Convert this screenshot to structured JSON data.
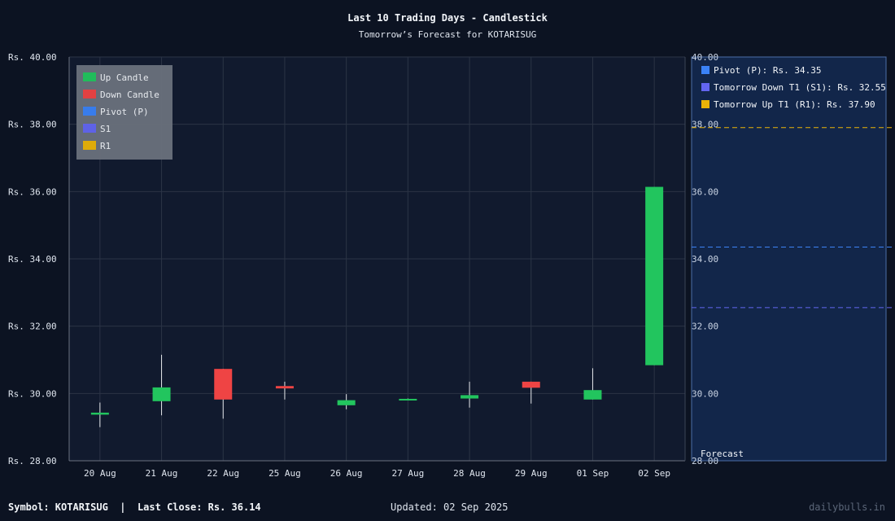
{
  "chart_data": {
    "type": "candlestick",
    "title": "Last 10 Trading Days - Candlestick",
    "subtitle": "Tomorrow’s Forecast for KOTARISUG",
    "categories": [
      "20 Aug",
      "21 Aug",
      "22 Aug",
      "25 Aug",
      "26 Aug",
      "27 Aug",
      "28 Aug",
      "29 Aug",
      "01 Sep",
      "02 Sep"
    ],
    "ohlc": [
      {
        "open": 29.37,
        "high": 29.73,
        "low": 29.0,
        "close": 29.43
      },
      {
        "open": 29.77,
        "high": 31.15,
        "low": 29.35,
        "close": 30.18
      },
      {
        "open": 30.73,
        "high": 30.73,
        "low": 29.25,
        "close": 29.82
      },
      {
        "open": 30.22,
        "high": 30.35,
        "low": 29.82,
        "close": 30.15
      },
      {
        "open": 29.65,
        "high": 29.98,
        "low": 29.53,
        "close": 29.8
      },
      {
        "open": 29.82,
        "high": 29.85,
        "low": 29.8,
        "close": 29.84
      },
      {
        "open": 29.85,
        "high": 30.35,
        "low": 29.58,
        "close": 29.95
      },
      {
        "open": 30.35,
        "high": 30.35,
        "low": 29.7,
        "close": 30.17
      },
      {
        "open": 29.82,
        "high": 30.75,
        "low": 29.82,
        "close": 30.1
      },
      {
        "open": 30.84,
        "high": 36.14,
        "low": 30.84,
        "close": 36.14
      }
    ],
    "y_tick_labels": [
      "Rs. 40.00",
      "Rs. 38.00",
      "Rs. 36.00",
      "Rs. 34.00",
      "Rs. 32.00",
      "Rs. 30.00",
      "Rs. 28.00"
    ],
    "y_tick_values": [
      40,
      38,
      36,
      34,
      32,
      30,
      28
    ],
    "right_tick_labels": [
      "40.00",
      "38.00",
      "36.00",
      "34.00",
      "32.00",
      "30.00",
      "28.00"
    ],
    "ylim": [
      28,
      40
    ],
    "grid": true,
    "legend": {
      "placement": "top-left",
      "items": [
        {
          "label": "Up Candle",
          "color": "#22c55e"
        },
        {
          "label": "Down Candle",
          "color": "#ef4444"
        },
        {
          "label": "Pivot (P)",
          "color": "#3b82f6"
        },
        {
          "label": "S1",
          "color": "#6366f1"
        },
        {
          "label": "R1",
          "color": "#eab308"
        }
      ]
    },
    "forecast": {
      "label": "Forecast",
      "levels": [
        {
          "label": "Pivot (P): Rs. 34.35",
          "value": 34.35,
          "color": "#3b82f6"
        },
        {
          "label": "Tomorrow Down T1 (S1): Rs. 32.55",
          "value": 32.55,
          "color": "#6366f1"
        },
        {
          "label": "Tomorrow Up T1 (R1): Rs. 37.90",
          "value": 37.9,
          "color": "#eab308"
        }
      ]
    },
    "colors": {
      "up": "#22c55e",
      "down": "#ef4444",
      "wick": "#e5e7eb",
      "grid": "#2b3445",
      "panel": "#111a2e",
      "forecast_panel": "#12264a",
      "forecast_border": "#4c6fa8"
    }
  },
  "footer": {
    "symbol_text": "Symbol: KOTARISUG  |  Last Close: Rs. 36.14",
    "updated_text": "Updated: 02 Sep 2025",
    "brand": "dailybulls.in"
  }
}
